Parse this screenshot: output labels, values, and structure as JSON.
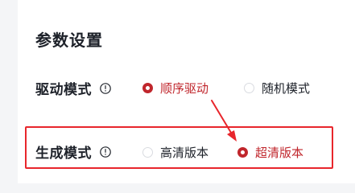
{
  "section": {
    "title": "参数设置"
  },
  "drive_mode": {
    "label": "驱动模式",
    "options": [
      {
        "label": "顺序驱动",
        "selected": true
      },
      {
        "label": "随机模式",
        "selected": false
      }
    ]
  },
  "generate_mode": {
    "label": "生成模式",
    "options": [
      {
        "label": "高清版本",
        "selected": false
      },
      {
        "label": "超清版本",
        "selected": true
      }
    ]
  },
  "colors": {
    "accent": "#c0262c",
    "highlight": "#e8262c",
    "text": "#1d2129",
    "background": "#f4f5f7"
  },
  "icons": {
    "info": "info-circle-icon"
  }
}
